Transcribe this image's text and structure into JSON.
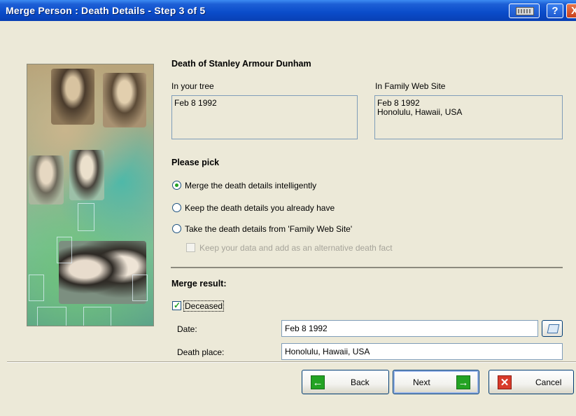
{
  "window": {
    "title": "Merge Person : Death Details - Step 3 of 5"
  },
  "titlebar": {
    "help_label": "?",
    "close_label": "X"
  },
  "header": {
    "heading": "Death of Stanley Armour Dunham"
  },
  "compare": {
    "your_tree": {
      "label": "In your tree",
      "value": "Feb 8 1992"
    },
    "web_site": {
      "label": "In Family Web Site",
      "value": "Feb 8 1992\nHonolulu, Hawaii, USA"
    }
  },
  "pick": {
    "heading": "Please pick",
    "options": [
      {
        "label": "Merge the death details intelligently",
        "selected": true
      },
      {
        "label": "Keep the death details you already have",
        "selected": false
      },
      {
        "label": "Take the death details from 'Family Web Site'",
        "selected": false
      }
    ],
    "alternative": {
      "label": "Keep your data and add as an alternative death fact",
      "checked": false,
      "enabled": false
    }
  },
  "result": {
    "heading": "Merge result:",
    "deceased": {
      "label": "Deceased",
      "checked": true
    },
    "date": {
      "label": "Date:",
      "value": "Feb 8 1992"
    },
    "place": {
      "label": "Death place:",
      "value": "Honolulu, Hawaii, USA"
    }
  },
  "buttons": {
    "back": "Back",
    "next": "Next",
    "cancel": "Cancel"
  },
  "colors": {
    "titlebar": "#0a4cc9",
    "window_bg": "#ece9d8",
    "accent_green": "#23a323",
    "accent_red": "#d83b2b"
  },
  "icons": [
    "keyboard-icon",
    "help-icon",
    "close-icon",
    "calendar-icon",
    "back-arrow-icon",
    "next-arrow-icon",
    "cancel-x-icon"
  ]
}
